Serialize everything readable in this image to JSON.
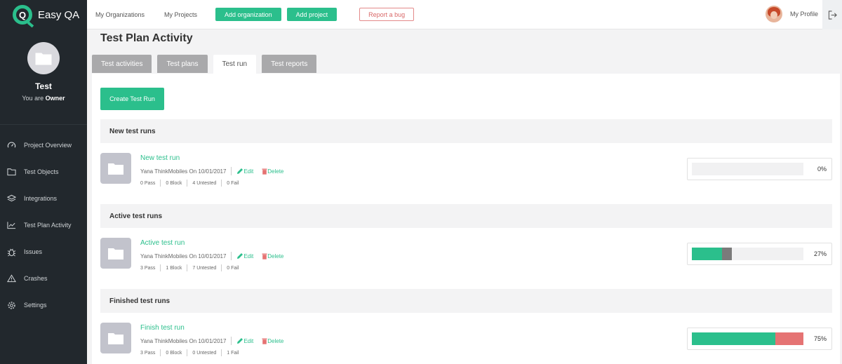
{
  "app": {
    "name": "Easy QA",
    "logo_letter": "Q"
  },
  "colors": {
    "accent": "#2bbf8c",
    "sidebar": "#22282d",
    "bug": "#d96868",
    "pass": "#2bbf8c",
    "block": "#7b7b7b",
    "fail": "#e57373"
  },
  "sidebar": {
    "project_name": "Test",
    "role_prefix": "You are",
    "role_value": "Owner",
    "items": [
      {
        "label": "Project Overview",
        "icon": "gauge-icon"
      },
      {
        "label": "Test Objects",
        "icon": "folder-icon"
      },
      {
        "label": "Integrations",
        "icon": "layers-icon"
      },
      {
        "label": "Test Plan Activity",
        "icon": "line-chart-icon"
      },
      {
        "label": "Issues",
        "icon": "bug-icon"
      },
      {
        "label": "Crashes",
        "icon": "warning-icon"
      },
      {
        "label": "Settings",
        "icon": "gear-icon"
      }
    ]
  },
  "topbar": {
    "my_organizations": "My Organizations",
    "my_projects": "My Projects",
    "add_organization": "Add organization",
    "add_project": "Add project",
    "report_bug": "Report a bug",
    "my_profile": "My Profile"
  },
  "page": {
    "title": "Test Plan Activity",
    "tabs": [
      {
        "label": "Test activities",
        "active": false
      },
      {
        "label": "Test plans",
        "active": false
      },
      {
        "label": "Test run",
        "active": true
      },
      {
        "label": "Test reports",
        "active": false
      }
    ],
    "create_button": "Create Test Run"
  },
  "sections": [
    {
      "heading": "New test runs",
      "run": {
        "title": "New test run",
        "author": "Yana ThinkMobiles On 10/01/2017",
        "edit": "Edit",
        "delete": "Delete",
        "stats": [
          "0 Pass",
          "0 Block",
          "4 Untested",
          "0 Fail"
        ],
        "percent_label": "0%",
        "pass_fraction": 0,
        "block_fraction": 0,
        "fail_fraction": 0
      }
    },
    {
      "heading": "Active test runs",
      "run": {
        "title": "Active test run",
        "author": "Yana ThinkMobiles On 10/01/2017",
        "edit": "Edit",
        "delete": "Delete",
        "stats": [
          "3 Pass",
          "1 Block",
          "7 Untested",
          "0 Fail"
        ],
        "percent_label": "27%",
        "pass_fraction": 0.27,
        "block_fraction": 0.09,
        "fail_fraction": 0
      }
    },
    {
      "heading": "Finished test runs",
      "run": {
        "title": "Finish test run",
        "author": "Yana ThinkMobiles On 10/01/2017",
        "edit": "Edit",
        "delete": "Delete",
        "stats": [
          "3 Pass",
          "0 Block",
          "0 Untested",
          "1 Fail"
        ],
        "percent_label": "75%",
        "pass_fraction": 0.75,
        "block_fraction": 0,
        "fail_fraction": 0.25
      }
    }
  ]
}
